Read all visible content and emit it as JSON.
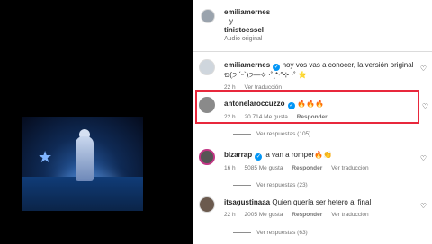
{
  "header": {
    "user1": "emiliamernes",
    "conj": "y",
    "user2": "tinistoessel",
    "audio": "Audio original"
  },
  "comments": [
    {
      "user": "emiliamernes",
      "verified": true,
      "text_line1": "hoy vos vas a conocer, la versión original",
      "text_line2": "ଘ(੭ ˊᵕˋ)੭—✧ ·˚˳*‧°⊹ ·˚ ⭐",
      "time": "22 h",
      "likes": "",
      "reply": "Ver traducción"
    },
    {
      "user": "antonelaroccuzzo",
      "verified": true,
      "text_line1": "🔥🔥🔥",
      "time": "22 h",
      "likes": "20.714 Me gusta",
      "reply": "Responder",
      "view_replies": "Ver respuestas (105)"
    },
    {
      "user": "bizarrap",
      "verified": true,
      "text_line1": "la van a romper🔥👏",
      "time": "16 h",
      "likes": "5085 Me gusta",
      "reply": "Responder",
      "translate": "Ver traducción",
      "view_replies": "Ver respuestas (23)"
    },
    {
      "user": "itsagustinaaa",
      "verified": false,
      "text_line1": "Quien quería ser hetero al final",
      "time": "22 h",
      "likes": "2005 Me gusta",
      "reply": "Responder",
      "translate": "Ver traducción",
      "view_replies": "Ver respuestas (63)"
    }
  ],
  "icons": {
    "heart": "heart-icon",
    "verified": "verified-badge-icon"
  },
  "colors": {
    "highlight": "#e8283c",
    "verified": "#0095f6"
  }
}
